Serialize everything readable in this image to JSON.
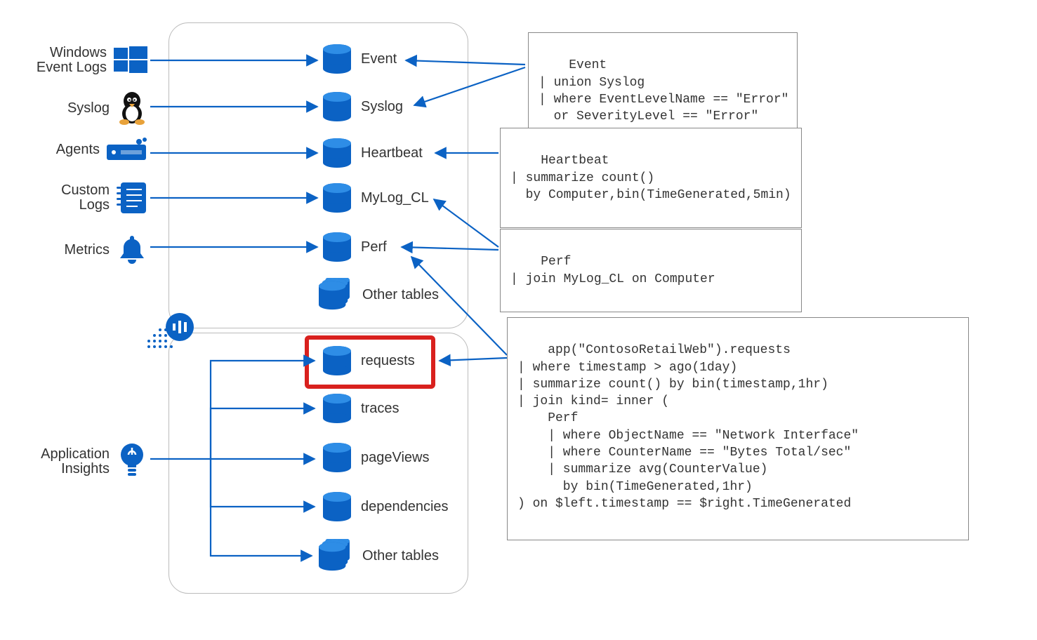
{
  "colors": {
    "azure": "#0b62c4",
    "line": "#0b62c4",
    "highlight": "#d9211e",
    "border": "#888"
  },
  "sources": {
    "windows": {
      "label_l1": "Windows",
      "label_l2": "Event Logs"
    },
    "syslog": {
      "label": "Syslog"
    },
    "agents": {
      "label": "Agents"
    },
    "custom": {
      "label_l1": "Custom",
      "label_l2": "Logs"
    },
    "metrics": {
      "label": "Metrics"
    },
    "appinsights": {
      "label_l1": "Application",
      "label_l2": "Insights"
    }
  },
  "tables": {
    "event": {
      "label": "Event"
    },
    "syslog": {
      "label": "Syslog"
    },
    "heartbeat": {
      "label": "Heartbeat"
    },
    "mylog": {
      "label": "MyLog_CL"
    },
    "perf": {
      "label": "Perf"
    },
    "other_top": {
      "label": "Other tables"
    },
    "requests": {
      "label": "requests"
    },
    "traces": {
      "label": "traces"
    },
    "pageviews": {
      "label": "pageViews"
    },
    "dependencies": {
      "label": "dependencies"
    },
    "other_bot": {
      "label": "Other tables"
    }
  },
  "queries": {
    "q1": "Event\n| union Syslog\n| where EventLevelName == \"Error\"\n  or SeverityLevel == \"Error\"",
    "q2": "Heartbeat\n| summarize count()\n  by Computer,bin(TimeGenerated,5min)",
    "q3": "Perf\n| join MyLog_CL on Computer",
    "q4": "app(\"ContosoRetailWeb\").requests\n| where timestamp > ago(1day)\n| summarize count() by bin(timestamp,1hr)\n| join kind= inner (\n    Perf\n    | where ObjectName == \"Network Interface\"\n    | where CounterName == \"Bytes Total/sec\"\n    | summarize avg(CounterValue)\n      by bin(TimeGenerated,1hr)\n) on $left.timestamp == $right.TimeGenerated"
  }
}
